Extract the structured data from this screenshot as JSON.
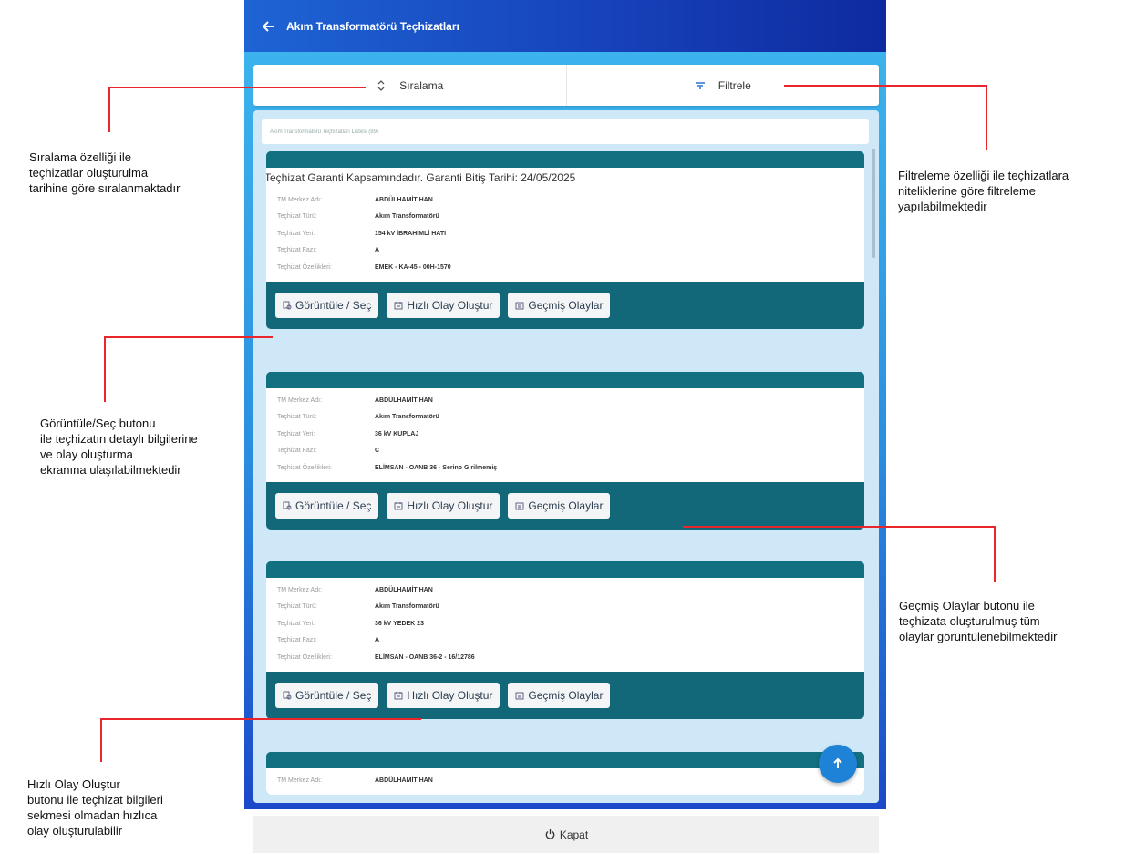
{
  "header": {
    "title": "Akım Transformatörü Teçhizatları"
  },
  "toolbar": {
    "sort_label": "Sıralama",
    "filter_label": "Filtrele"
  },
  "list": {
    "header": "Akım Transformatörü Teçhizatları Listesi (89)"
  },
  "field_labels": {
    "center": "TM Merkez Adı:",
    "type": "Teçhizat Türü:",
    "location": "Teçhizat Yeri:",
    "phase": "Teçhizat Fazı:",
    "specs": "Teçhizat Özellikleri:"
  },
  "buttons": {
    "view": "Görüntüle / Seç",
    "quick": "Hızlı Olay Oluştur",
    "history": "Geçmiş Olaylar"
  },
  "cards": [
    {
      "warranty": "Teçhizat Garanti Kapsamındadır. Garanti Bitiş Tarihi: 24/05/2025",
      "center": "ABDÜLHAMİT HAN",
      "type": "Akım Transformatörü",
      "location": "154 kV İBRAHİMLİ HATI",
      "phase": "A",
      "specs": "EMEK - KA-45 - 00H-1570"
    },
    {
      "center": "ABDÜLHAMİT HAN",
      "type": "Akım Transformatörü",
      "location": "36 kV KUPLAJ",
      "phase": "C",
      "specs": "ELİMSAN - OANB 36 - Serino Girilmemiş"
    },
    {
      "center": "ABDÜLHAMİT HAN",
      "type": "Akım Transformatörü",
      "location": "36 kV YEDEK 23",
      "phase": "A",
      "specs": "ELİMSAN - OANB 36-2 - 16/12786"
    },
    {
      "center": "ABDÜLHAMİT HAN"
    }
  ],
  "footer": {
    "close_label": "Kapat"
  },
  "annotations": {
    "sort": [
      "Sıralama özelliği ile",
      "teçhizatlar oluşturulma",
      "tarihine göre sıralanmaktadır"
    ],
    "filter": [
      "Filtreleme özelliği ile teçhizatlara",
      "niteliklerine göre filtreleme",
      "yapılabilmektedir"
    ],
    "view": [
      "Görüntüle/Seç butonu",
      "ile teçhizatın detaylı bilgilerine",
      "ve olay oluşturma",
      "ekranına ulaşılabilmektedir"
    ],
    "history": [
      "Geçmiş Olaylar butonu ile",
      "teçhizata oluşturulmuş tüm",
      "olaylar görüntülenebilmektedir"
    ],
    "quick": [
      "Hızlı Olay Oluştur",
      "butonu ile teçhizat bilgileri",
      "sekmesi olmadan hızlıca",
      "olay oluşturulabilir"
    ]
  },
  "colors": {
    "annotation_line": "#e8262c",
    "card_teal": "#126878",
    "topbar": "#1640b8"
  }
}
